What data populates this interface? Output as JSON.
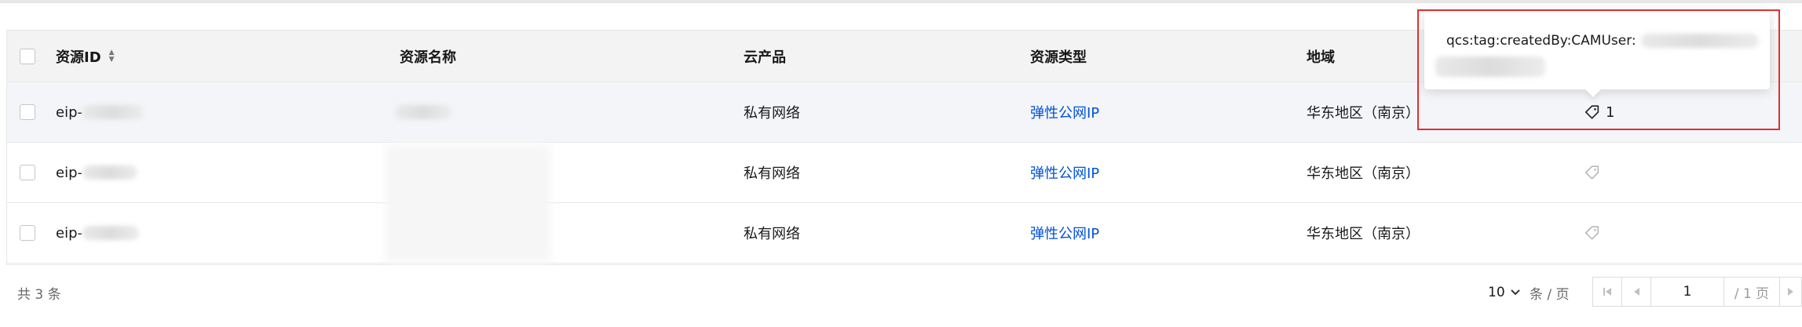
{
  "table": {
    "columns": {
      "resource_id": "资源ID",
      "resource_name": "资源名称",
      "cloud_product": "云产品",
      "resource_type": "资源类型",
      "region": "地域"
    },
    "rows": [
      {
        "id_prefix": "eip-",
        "cloud_product": "私有网络",
        "resource_type": "弹性公网IP",
        "region": "华东地区（南京）",
        "tag_count": "1"
      },
      {
        "id_prefix": "eip-",
        "cloud_product": "私有网络",
        "resource_type": "弹性公网IP",
        "region": "华东地区（南京）",
        "tag_count": ""
      },
      {
        "id_prefix": "eip-",
        "cloud_product": "私有网络",
        "resource_type": "弹性公网IP",
        "region": "华东地区（南京）",
        "tag_count": ""
      }
    ]
  },
  "tooltip": {
    "text": "qcs:tag:createdBy:CAMUser:"
  },
  "footer": {
    "total": "共 3 条",
    "page_size": "10",
    "per_page_label": "条 / 页",
    "current_page": "1",
    "total_pages_label": "/ 1 页"
  },
  "colors": {
    "link": "#0052d9",
    "highlight": "#e0302f"
  }
}
